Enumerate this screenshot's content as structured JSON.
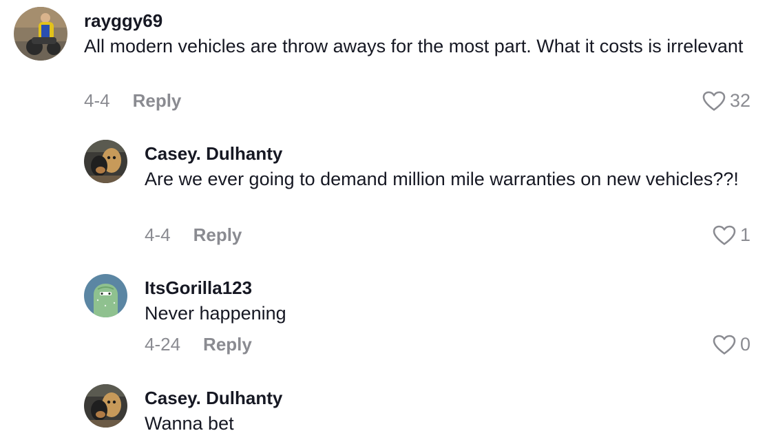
{
  "comments": [
    {
      "username": "rayggy69",
      "text": "All modern vehicles are throw aways for the most part. What it costs is irrelevant",
      "date": "4-4",
      "reply_label": "Reply",
      "likes": "32"
    },
    {
      "username": "Casey. Dulhanty",
      "text": "Are we ever going to demand million mile warranties on new vehicles??!",
      "date": "4-4",
      "reply_label": "Reply",
      "likes": "1"
    },
    {
      "username": "ItsGorilla123",
      "text": "Never happening",
      "date": "4-24",
      "reply_label": "Reply",
      "likes": "0"
    },
    {
      "username": "Casey. Dulhanty",
      "text": "Wanna bet",
      "date": "",
      "reply_label": "",
      "likes": ""
    }
  ],
  "colors": {
    "text": "#161823",
    "secondary": "#8a8b91",
    "gorilla_avatar_bg": "#5b86a3"
  },
  "icons": {
    "like": "heart-outline-icon"
  }
}
